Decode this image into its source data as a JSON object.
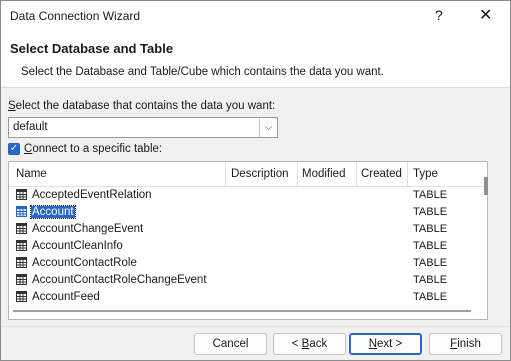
{
  "titlebar": {
    "title": "Data Connection Wizard",
    "help": "?",
    "close": "✕"
  },
  "header": {
    "title": "Select Database and Table",
    "subtitle": "Select the Database and Table/Cube which contains the data you want."
  },
  "database": {
    "label_accel": "S",
    "label_rest": "elect the database that contains the data you want:",
    "value": "default"
  },
  "specific_table": {
    "checked": true,
    "label_accel": "C",
    "label_rest": "onnect to a specific table:"
  },
  "table": {
    "columns": {
      "name": "Name",
      "description": "Description",
      "modified": "Modified",
      "created": "Created",
      "type": "Type"
    },
    "rows": [
      {
        "name": "AcceptedEventRelation",
        "type": "TABLE",
        "selected": false
      },
      {
        "name": "Account",
        "type": "TABLE",
        "selected": true
      },
      {
        "name": "AccountChangeEvent",
        "type": "TABLE",
        "selected": false
      },
      {
        "name": "AccountCleanInfo",
        "type": "TABLE",
        "selected": false
      },
      {
        "name": "AccountContactRole",
        "type": "TABLE",
        "selected": false
      },
      {
        "name": "AccountContactRoleChangeEvent",
        "type": "TABLE",
        "selected": false
      },
      {
        "name": "AccountFeed",
        "type": "TABLE",
        "selected": false
      }
    ]
  },
  "footer": {
    "cancel": "Cancel",
    "back_prefix": "< ",
    "back_accel": "B",
    "back_rest": "ack",
    "next_accel": "N",
    "next_rest": "ext >",
    "finish_accel": "F",
    "finish_rest": "inish"
  },
  "colors": {
    "accent": "#2a66c8"
  }
}
